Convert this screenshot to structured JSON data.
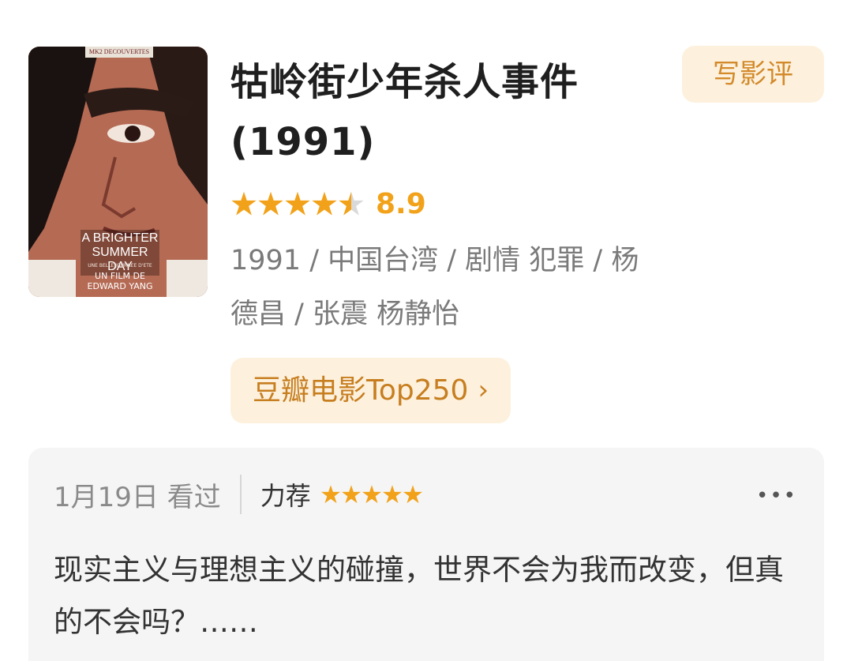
{
  "movie": {
    "title": "牯岭街少年杀人事件(1991)",
    "rating": {
      "score": "8.9",
      "stars": 4.5,
      "max_stars": 5
    },
    "meta": "1991 / 中国台湾 / 剧情 犯罪 / 杨德昌 / 张震 杨静怡",
    "top_tag": "豆瓣电影Top250"
  },
  "poster": {
    "brand": "MK2 DECOUVERTES",
    "title": "A BRIGHTER SUMMER DAY",
    "subtitle": "UNE BELLE JOURNEE D'ETE",
    "director": "UN FILM DE EDWARD YANG"
  },
  "actions": {
    "write_review": "写影评"
  },
  "my_review": {
    "date": "1月19日 看过",
    "recommend": "力荐",
    "stars": 5,
    "text": "现实主义与理想主义的碰撞，世界不会为我而改变，但真的不会吗？……",
    "more": "•••"
  },
  "colors": {
    "accent": "#f2a21a",
    "tag_bg": "#fdf1de",
    "tag_text": "#c77e1f",
    "card_bg": "#f5f5f5"
  }
}
